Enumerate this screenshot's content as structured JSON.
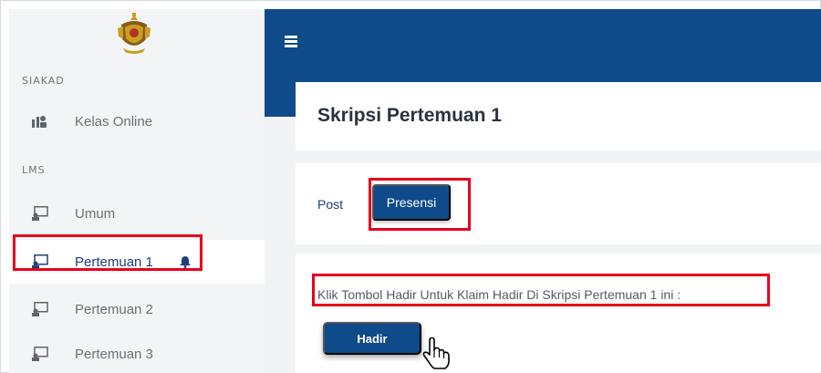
{
  "sidebar": {
    "logo_icon": "crest-logo",
    "sections": [
      {
        "label": "SIAKAD"
      },
      {
        "label": "LMS"
      }
    ],
    "items": [
      {
        "label": "Kelas Online",
        "icon": "classroom-icon"
      },
      {
        "label": "Umum",
        "icon": "chalkboard-icon"
      },
      {
        "label": "Pertemuan 1",
        "icon": "chalkboard-icon",
        "active": true,
        "badge_icon": "bell-icon"
      },
      {
        "label": "Pertemuan 2",
        "icon": "chalkboard-icon"
      },
      {
        "label": "Pertemuan 3",
        "icon": "chalkboard-icon"
      }
    ]
  },
  "header": {
    "menu_icon": "hamburger-icon"
  },
  "main": {
    "title": "Skripsi Pertemuan 1",
    "tabs": [
      {
        "label": "Post"
      },
      {
        "label": "Presensi",
        "selected": true
      }
    ],
    "instruction": "Klik Tombol Hadir Untuk Klaim Hadir Di Skripsi Pertemuan 1 ini :",
    "hadir_label": "Hadir",
    "cursor_icon": "hand-pointer-icon"
  },
  "colors": {
    "primary": "#0f4a8a",
    "highlight": "#e8001c",
    "sidebar_bg": "#f3f4f6",
    "content_bg": "#f2f3f5"
  }
}
